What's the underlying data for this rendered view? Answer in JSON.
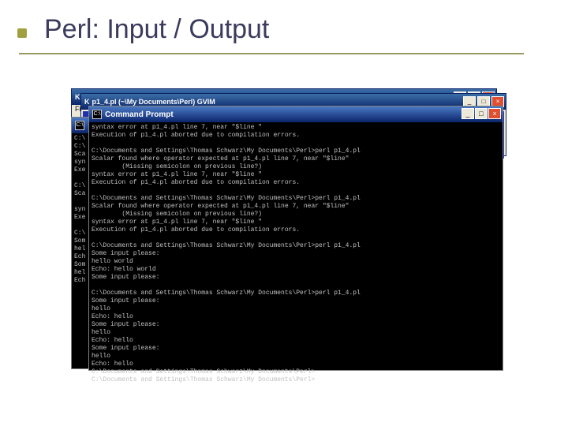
{
  "slide": {
    "title": "Perl: Input / Output"
  },
  "bg_editor": {
    "title_prefix": "K",
    "title_full": "p1_4.pl (~\\My Documents\\Perl)  GVIM",
    "menu_item_file": "File"
  },
  "cmd": {
    "title": "Command Prompt",
    "minimize": "_",
    "maximize": "□",
    "close": "×",
    "back_lines": [
      "C:\\",
      "C:\\",
      "Sca",
      "syn",
      "Exe",
      "",
      "C:\\",
      "Sca",
      "",
      "syn",
      "Exe",
      "",
      "C:\\",
      "Som",
      "hel",
      "Ech",
      "Som",
      "hel",
      "Ech"
    ],
    "front_lines": [
      "syntax error at p1_4.pl line 7, near \"$line \"",
      "Execution of p1_4.pl aborted due to compilation errors.",
      "",
      "C:\\Documents and Settings\\Thomas Schwarz\\My Documents\\Perl>perl p1_4.pl",
      "Scalar found where operator expected at p1_4.pl line 7, near \"$line\"",
      "        (Missing semicolon on previous line?)",
      "syntax error at p1_4.pl line 7, near \"$line \"",
      "Execution of p1_4.pl aborted due to compilation errors.",
      "",
      "C:\\Documents and Settings\\Thomas Schwarz\\My Documents\\Perl>perl p1_4.pl",
      "Scalar found where operator expected at p1_4.pl line 7, near \"$line\"",
      "        (Missing semicolon on previous line?)",
      "syntax error at p1_4.pl line 7, near \"$line \"",
      "Execution of p1_4.pl aborted due to compilation errors.",
      "",
      "C:\\Documents and Settings\\Thomas Schwarz\\My Documents\\Perl>perl p1_4.pl",
      "Some input please:",
      "hello world",
      "Echo: hello world",
      "Some input please:",
      "",
      "C:\\Documents and Settings\\Thomas Schwarz\\My Documents\\Perl>perl p1_4.pl",
      "Some input please:",
      "hello",
      "Echo: hello",
      "Some input please:",
      "hello",
      "Echo: hello",
      "Some input please:",
      "hello",
      "Echo: hello",
      "C:\\Documents and Settings\\Thomas Schwarz\\My Documents\\Perl>",
      "C:\\Documents and Settings\\Thomas Schwarz\\My Documents\\Perl>"
    ]
  }
}
